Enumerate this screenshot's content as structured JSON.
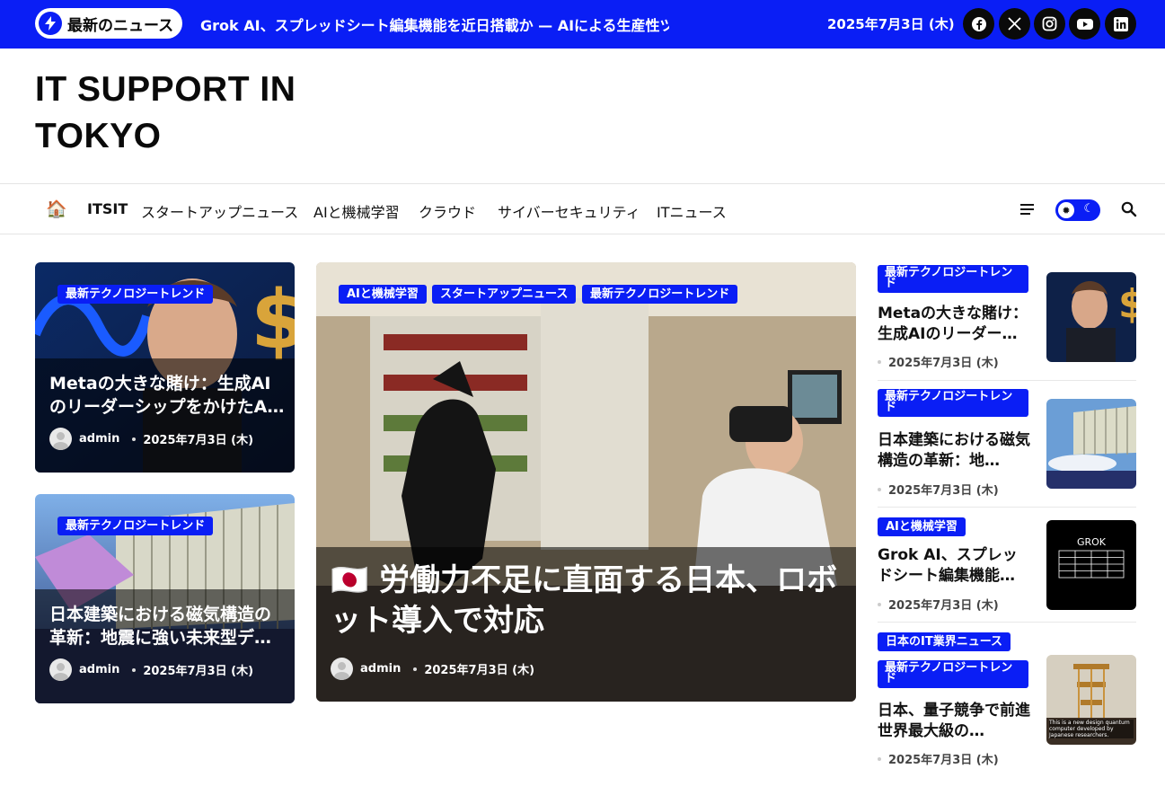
{
  "topbar": {
    "breaking_label": "最新のニュース",
    "ticker_text": "Grok AI、スプレッドシート編集機能を近日搭載か — AIによる生産性ツール",
    "date": "2025年7月3日 (木)",
    "social": [
      "facebook-icon",
      "x-icon",
      "instagram-icon",
      "youtube-icon",
      "linkedin-icon"
    ]
  },
  "site": {
    "title_line1": "IT SUPPORT IN",
    "title_line2": "TOKYO"
  },
  "nav": {
    "home_icon": "🏠",
    "items": [
      "ITSIT",
      "スタートアップニュース",
      "AIと機械学習",
      "クラウド",
      "サイバーセキュリティ",
      "ITニュース"
    ]
  },
  "left_cards": [
    {
      "tag": "最新テクノロジートレンド",
      "title": "Metaの大きな賭け：生成AIのリーダーシップをかけたA…",
      "author": "admin",
      "date": "2025年7月3日 (木)"
    },
    {
      "tag": "最新テクノロジートレンド",
      "title": "日本建築における磁気構造の革新：地震に強い未来型デ…",
      "author": "admin",
      "date": "2025年7月3日 (木)"
    }
  ],
  "feature": {
    "tags": [
      "AIと機械学習",
      "スタートアップニュース",
      "最新テクノロジートレンド"
    ],
    "title": "🇯🇵 労働力不足に直面する日本、ロボット導入で対応",
    "author": "admin",
    "date": "2025年7月3日 (木)"
  },
  "sidebar": [
    {
      "tags": [
        "最新テクノロジートレンド"
      ],
      "title": "Metaの大きな賭け：生成AIのリーダー…",
      "date": "2025年7月3日 (木)"
    },
    {
      "tags": [
        "最新テクノロジートレンド"
      ],
      "title": "日本建築における磁気構造の革新：地…",
      "date": "2025年7月3日 (木)"
    },
    {
      "tags": [
        "AIと機械学習"
      ],
      "title": "Grok AI、スプレッドシート編集機能…",
      "date": "2025年7月3日 (木)",
      "thumb_text": "GROK"
    },
    {
      "tags": [
        "日本のIT業界ニュース",
        "最新テクノロジートレンド"
      ],
      "title": "日本、量子競争で前進　世界最大級の…",
      "date": "2025年7月3日 (木)",
      "thumb_caption": "This is a new design quantum computer developed by Japanese researchers."
    }
  ],
  "colors": {
    "accent": "#0a1ef5",
    "dark": "#0a0a0a"
  }
}
